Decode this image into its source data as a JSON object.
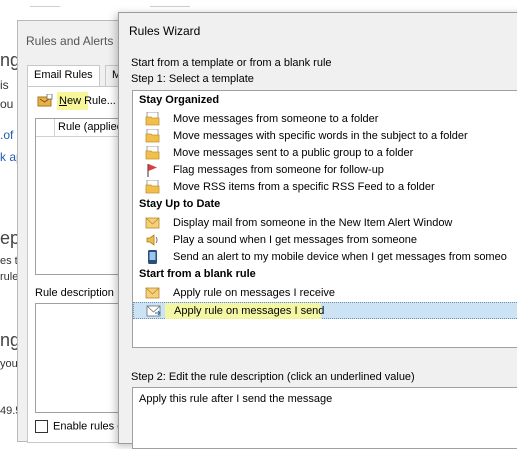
{
  "background": {
    "fragments": [
      "ng",
      "is",
      "ou",
      ".of",
      "k ap",
      "epl",
      "es to",
      "rules",
      "ng",
      "you",
      "49.5"
    ]
  },
  "rules_alerts": {
    "title": "Rules and Alerts",
    "tabs": [
      "Email Rules",
      "Ma"
    ],
    "new_rule": {
      "label_u": "N",
      "label_rest": "ew Rule..."
    },
    "rule_column": "Rule (applied",
    "rule_description_label": "Rule description",
    "enable_label": "Enable rules o"
  },
  "wizard": {
    "title": "Rules Wizard",
    "subtitle": "Start from a template or from a blank rule",
    "step1": "Step 1: Select a template",
    "groups": [
      {
        "name": "Stay Organized",
        "items": [
          {
            "icon": "folder-envelope-icon",
            "label": "Move messages from someone to a folder"
          },
          {
            "icon": "folder-envelope-icon",
            "label": "Move messages with specific words in the subject to a folder"
          },
          {
            "icon": "folder-envelope-icon",
            "label": "Move messages sent to a public group to a folder"
          },
          {
            "icon": "red-flag-icon",
            "label": "Flag messages from someone for follow-up"
          },
          {
            "icon": "folder-envelope-icon",
            "label": "Move RSS items from a specific RSS Feed to a folder"
          }
        ]
      },
      {
        "name": "Stay Up to Date",
        "items": [
          {
            "icon": "alert-envelope-icon",
            "label": "Display mail from someone in the New Item Alert Window"
          },
          {
            "icon": "speaker-icon",
            "label": "Play a sound when I get messages from someone"
          },
          {
            "icon": "mobile-phone-icon",
            "label": "Send an alert to my mobile device when I get messages from someo"
          }
        ]
      },
      {
        "name": "Start from a blank rule",
        "items": [
          {
            "icon": "envelope-icon",
            "label": "Apply rule on messages I receive"
          },
          {
            "icon": "envelope-send-icon",
            "label": "Apply rule on messages I send",
            "selected": true
          }
        ]
      }
    ],
    "step2": "Step 2: Edit the rule description (click an underlined value)",
    "description": "Apply this rule after I send the message"
  }
}
